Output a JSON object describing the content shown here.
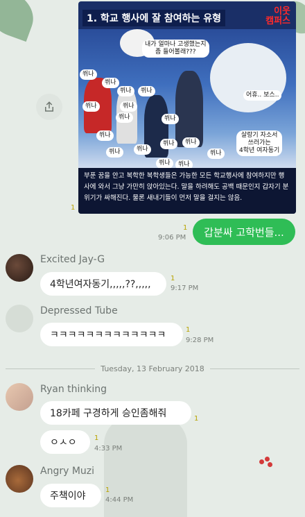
{
  "image_message": {
    "title": "1. 학교 행사에 잘 참여하는 유형",
    "logo_line1": "이웃",
    "logo_line2": "캠퍼스",
    "speech_1": "내가 얼마나 고생했는지\n좀 들어볼래???",
    "speech_2": "어휴.. 보스..",
    "speech_3": "살랑기 자소서\n쓰러가는\n4학년 여자동기",
    "whoosh_label": "쒸나",
    "caption": "부푼 꿈을 안고 복학한 복학생들은 가능한 모든 학교행사에 참여하지만 행사에 와서 그냥 가만히 앉아있는다. 말을 하려해도 공백 때문인지 갑자기 분위기가 싸해진다. 물론 새내기들이 먼저 말을 걸지는 않음.",
    "unread": "1"
  },
  "my_message": {
    "text": "갑분싸 고학번들...",
    "unread": "1",
    "time": "9:06 PM"
  },
  "messages": [
    {
      "sender": "Excited Jay-G",
      "text": "4학년여자동기,,,,,??,,,,,",
      "unread": "1",
      "time": "9:17 PM"
    },
    {
      "sender": "Depressed Tube",
      "text": "ㅋㅋㅋㅋㅋㅋㅋㅋㅋㅋㅋㅋㅋ",
      "unread": "1",
      "time": "9:28 PM"
    },
    {
      "sender": "Ryan thinking",
      "text": "18카페 구경하게 승인좀해줘",
      "unread": "1",
      "text2": "ㅇㅅㅇ",
      "unread2": "1",
      "time": "4:33 PM"
    },
    {
      "sender": "Angry Muzi",
      "text": "주책이야",
      "unread": "1",
      "time": "4:44 PM"
    }
  ],
  "date_divider": "Tuesday, 13 February 2018",
  "colors": {
    "my_bubble": "#2fbd56",
    "background": "#e6ece7",
    "unread": "#b8a300"
  },
  "icons": {
    "share": "share-icon"
  }
}
